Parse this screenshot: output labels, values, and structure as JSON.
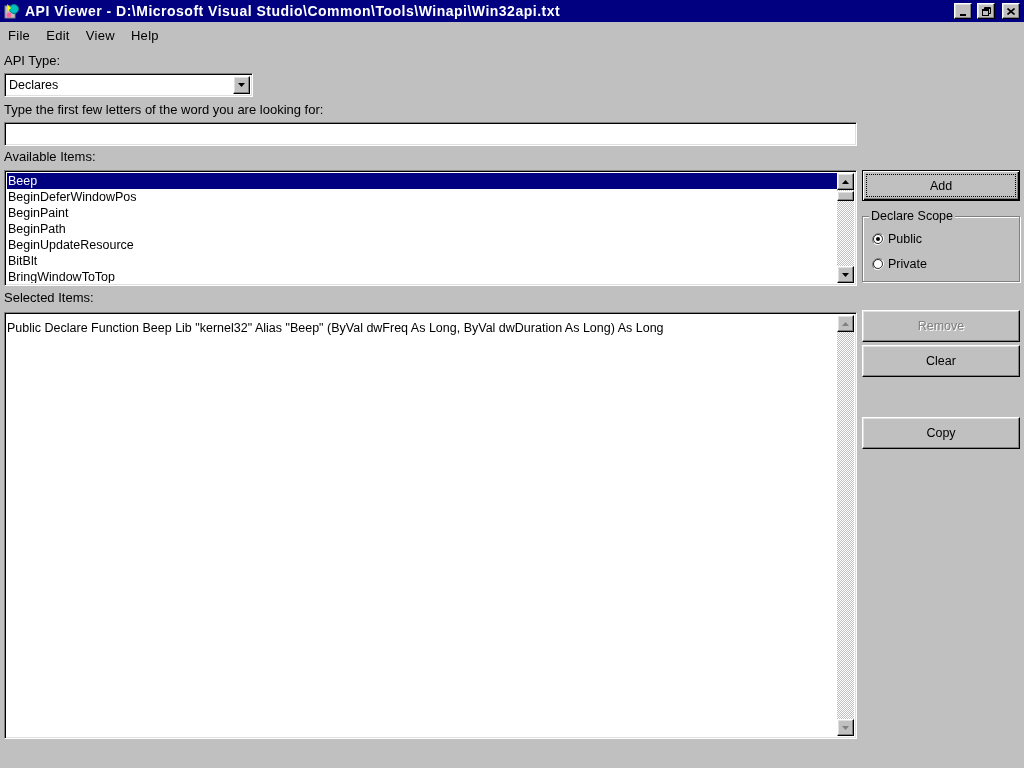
{
  "window": {
    "title": "API Viewer - D:\\Microsoft Visual Studio\\Common\\Tools\\Winapi\\Win32api.txt"
  },
  "menu": [
    {
      "label": "File"
    },
    {
      "label": "Edit"
    },
    {
      "label": "View"
    },
    {
      "label": "Help"
    }
  ],
  "api_type": {
    "label": "API Type:",
    "value": "Declares"
  },
  "search": {
    "label": "Type the first few letters of the word you are looking for:"
  },
  "available_items": {
    "label": "Available Items:",
    "items": [
      {
        "text": "Beep",
        "selected": true
      },
      {
        "text": "BeginDeferWindowPos",
        "selected": false
      },
      {
        "text": "BeginPaint",
        "selected": false
      },
      {
        "text": "BeginPath",
        "selected": false
      },
      {
        "text": "BeginUpdateResource",
        "selected": false
      },
      {
        "text": "BitBlt",
        "selected": false
      },
      {
        "text": "BringWindowToTop",
        "selected": false
      }
    ]
  },
  "add_button": {
    "label": "Add",
    "default": true,
    "disabled": false
  },
  "declare_scope": {
    "title": "Declare Scope",
    "options": [
      {
        "label": "Public",
        "selected": true
      },
      {
        "label": "Private",
        "selected": false
      }
    ]
  },
  "selected_items": {
    "label": "Selected Items:",
    "text": "Public Declare Function Beep Lib \"kernel32\" Alias \"Beep\" (ByVal dwFreq As Long, ByVal dwDuration As Long) As Long"
  },
  "edit_buttons": [
    {
      "label": "Remove",
      "disabled": true
    },
    {
      "label": "Clear",
      "disabled": false
    }
  ],
  "copy_button": {
    "label": "Copy",
    "disabled": false
  }
}
